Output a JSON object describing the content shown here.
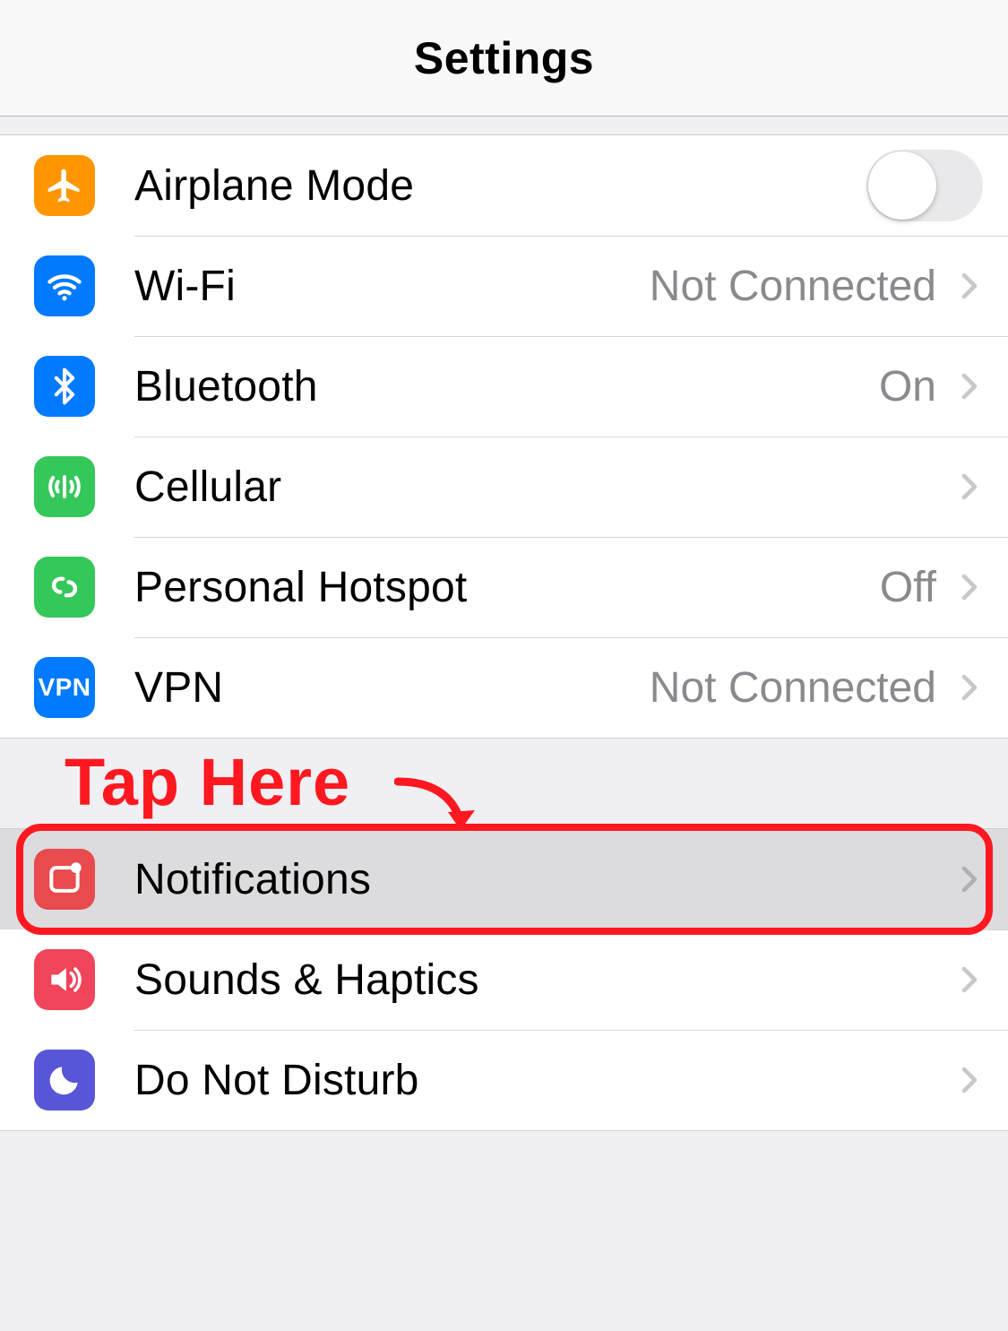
{
  "header": {
    "title": "Settings"
  },
  "group1": {
    "airplane": {
      "label": "Airplane Mode",
      "icon": "airplane-icon",
      "toggle": false
    },
    "wifi": {
      "label": "Wi-Fi",
      "value": "Not Connected",
      "icon": "wifi-icon"
    },
    "bluetooth": {
      "label": "Bluetooth",
      "value": "On",
      "icon": "bluetooth-icon"
    },
    "cellular": {
      "label": "Cellular",
      "icon": "cellular-icon"
    },
    "hotspot": {
      "label": "Personal Hotspot",
      "value": "Off",
      "icon": "hotspot-icon"
    },
    "vpn": {
      "label": "VPN",
      "value": "Not Connected",
      "icon": "vpn-icon",
      "icon_text": "VPN"
    }
  },
  "group2": {
    "notifications": {
      "label": "Notifications",
      "icon": "notifications-icon"
    },
    "sounds": {
      "label": "Sounds & Haptics",
      "icon": "sounds-icon"
    },
    "dnd": {
      "label": "Do Not Disturb",
      "icon": "dnd-icon"
    }
  },
  "annotation": {
    "text": "Tap Here",
    "target": "notifications-row",
    "color": "#ff181f"
  }
}
